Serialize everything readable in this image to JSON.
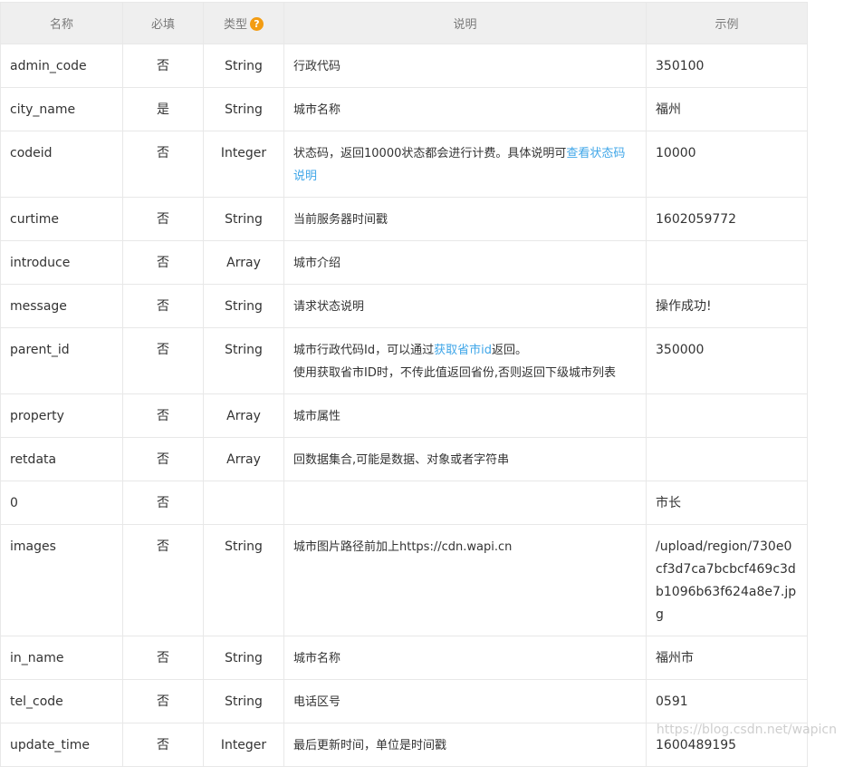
{
  "headers": {
    "name": "名称",
    "required": "必填",
    "type": "类型",
    "type_help_icon": "?",
    "desc": "说明",
    "example": "示例"
  },
  "rows": [
    {
      "name": "admin_code",
      "required": "否",
      "type": "String",
      "desc": "行政代码",
      "example": "350100"
    },
    {
      "name": "city_name",
      "required": "是",
      "type": "String",
      "desc": "城市名称",
      "example": "福州"
    },
    {
      "name": "codeid",
      "required": "否",
      "type": "Integer",
      "desc_pre": "状态码，返回10000状态都会进行计费。具体说明可",
      "desc_link": "查看状态码说明",
      "example": "10000"
    },
    {
      "name": "curtime",
      "required": "否",
      "type": "String",
      "desc": "当前服务器时间戳",
      "example": "1602059772"
    },
    {
      "name": "introduce",
      "required": "否",
      "type": "Array",
      "desc": "城市介绍",
      "example": ""
    },
    {
      "name": "message",
      "required": "否",
      "type": "String",
      "desc": "请求状态说明",
      "example": "操作成功!"
    },
    {
      "name": "parent_id",
      "required": "否",
      "type": "String",
      "desc_pre": "城市行政代码Id，可以通过",
      "desc_link": "获取省市id",
      "desc_post": "返回。",
      "desc_line2": "使用获取省市ID时，不传此值返回省份,否则返回下级城市列表",
      "example": "350000"
    },
    {
      "name": "property",
      "required": "否",
      "type": "Array",
      "desc": "城市属性",
      "example": ""
    },
    {
      "name": "retdata",
      "required": "否",
      "type": "Array",
      "desc": "回数据集合,可能是数据、对象或者字符串",
      "example": ""
    },
    {
      "name": "0",
      "required": "否",
      "type": "",
      "desc": "",
      "example": "市长"
    },
    {
      "name": "images",
      "required": "否",
      "type": "String",
      "desc": "城市图片路径前加上https://cdn.wapi.cn",
      "example": "/upload/region/730e0cf3d7ca7bcbcf469c3db1096b63f624a8e7.jpg"
    },
    {
      "name": "in_name",
      "required": "否",
      "type": "String",
      "desc": "城市名称",
      "example": "福州市"
    },
    {
      "name": "tel_code",
      "required": "否",
      "type": "String",
      "desc": "电话区号",
      "example": "0591"
    },
    {
      "name": "update_time",
      "required": "否",
      "type": "Integer",
      "desc": "最后更新时间，单位是时间戳",
      "example": "1600489195"
    }
  ],
  "watermark": "https://blog.csdn.net/wapicn",
  "colors": {
    "link": "#3fa6e8",
    "header_bg": "#efefef",
    "help_icon": "#f39c12",
    "border": "#e8e8e8"
  }
}
